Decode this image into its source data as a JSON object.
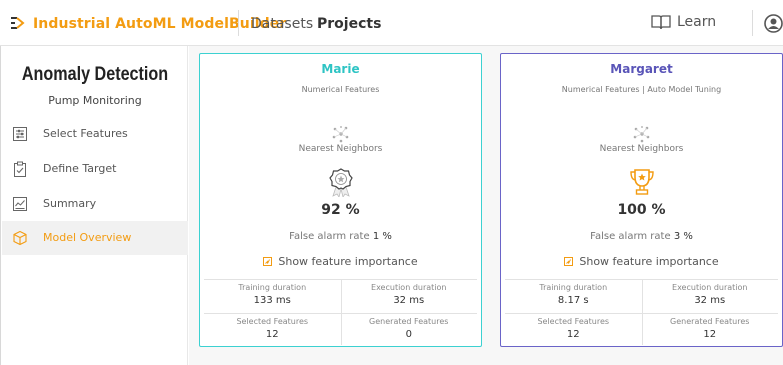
{
  "header": {
    "brand": "Industrial AutoML ModelBuilder",
    "nav": {
      "datasets": "Datasets",
      "projects": "Projects"
    },
    "learn": "Learn",
    "accent_color": "#f39c12"
  },
  "sidebar": {
    "title": "Anomaly Detection",
    "subtitle": "Pump Monitoring",
    "items": [
      {
        "label": "Select Features",
        "icon": "sliders-icon"
      },
      {
        "label": "Define Target",
        "icon": "clipboard-check-icon"
      },
      {
        "label": "Summary",
        "icon": "chart-icon"
      },
      {
        "label": "Model Overview",
        "icon": "cube-icon",
        "active": true
      }
    ]
  },
  "models": [
    {
      "name": "Marie",
      "features": "Numerical Features",
      "algorithm": "Nearest Neighbors",
      "award": "badge-icon",
      "score": "92 %",
      "false_alarm_label": "False alarm rate",
      "false_alarm_value": "1 %",
      "show_importance": "Show feature importance",
      "stats": {
        "training_duration_label": "Training duration",
        "training_duration": "133 ms",
        "execution_duration_label": "Execution duration",
        "execution_duration": "32 ms",
        "selected_features_label": "Selected Features",
        "selected_features": "12",
        "generated_features_label": "Generated Features",
        "generated_features": "0"
      },
      "border_color": "#3cd1d1"
    },
    {
      "name": "Margaret",
      "features": "Numerical Features | Auto Model Tuning",
      "algorithm": "Nearest Neighbors",
      "award": "trophy-icon",
      "score": "100 %",
      "false_alarm_label": "False alarm rate",
      "false_alarm_value": "3 %",
      "show_importance": "Show feature importance",
      "stats": {
        "training_duration_label": "Training duration",
        "training_duration": "8.17 s",
        "execution_duration_label": "Execution duration",
        "execution_duration": "32 ms",
        "selected_features_label": "Selected Features",
        "selected_features": "12",
        "generated_features_label": "Generated Features",
        "generated_features": "12"
      },
      "border_color": "#6a64c8"
    }
  ]
}
